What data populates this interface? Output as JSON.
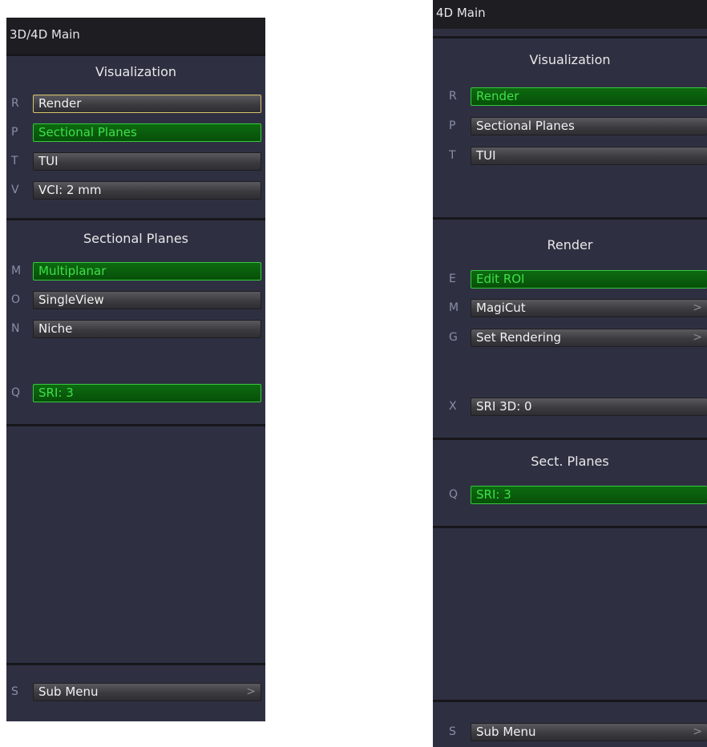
{
  "left": {
    "title": "3D/4D Main",
    "visualization": {
      "heading": "Visualization",
      "items": [
        {
          "key": "R",
          "label": "Render"
        },
        {
          "key": "P",
          "label": "Sectional Planes"
        },
        {
          "key": "T",
          "label": "TUI"
        },
        {
          "key": "V",
          "label": "VCI: 2 mm"
        }
      ]
    },
    "sectional_planes": {
      "heading": "Sectional Planes",
      "items": [
        {
          "key": "M",
          "label": "Multiplanar"
        },
        {
          "key": "O",
          "label": "SingleView"
        },
        {
          "key": "N",
          "label": "Niche"
        }
      ],
      "sri": {
        "key": "Q",
        "label": "SRI: 3"
      }
    },
    "sub_menu": {
      "key": "S",
      "label": "Sub Menu",
      "chevron": ">"
    }
  },
  "right": {
    "title": "4D Main",
    "visualization": {
      "heading": "Visualization",
      "items": [
        {
          "key": "R",
          "label": "Render"
        },
        {
          "key": "P",
          "label": "Sectional Planes"
        },
        {
          "key": "T",
          "label": "TUI"
        }
      ]
    },
    "render": {
      "heading": "Render",
      "items": [
        {
          "key": "E",
          "label": "Edit ROI"
        },
        {
          "key": "M",
          "label": "MagiCut",
          "chevron": ">"
        },
        {
          "key": "G",
          "label": "Set Rendering",
          "chevron": ">"
        }
      ],
      "sri": {
        "key": "X",
        "label": "SRI 3D: 0"
      }
    },
    "sect_planes": {
      "heading": "Sect. Planes",
      "sri": {
        "key": "Q",
        "label": "SRI: 3"
      }
    },
    "sub_menu": {
      "key": "S",
      "label": "Sub Menu",
      "chevron": ">"
    }
  },
  "colors": {
    "panel_bg": "#2e3042",
    "active_green_bg": "#075009",
    "active_green_text": "#3ee04a",
    "focus_border": "#d8c46a"
  }
}
